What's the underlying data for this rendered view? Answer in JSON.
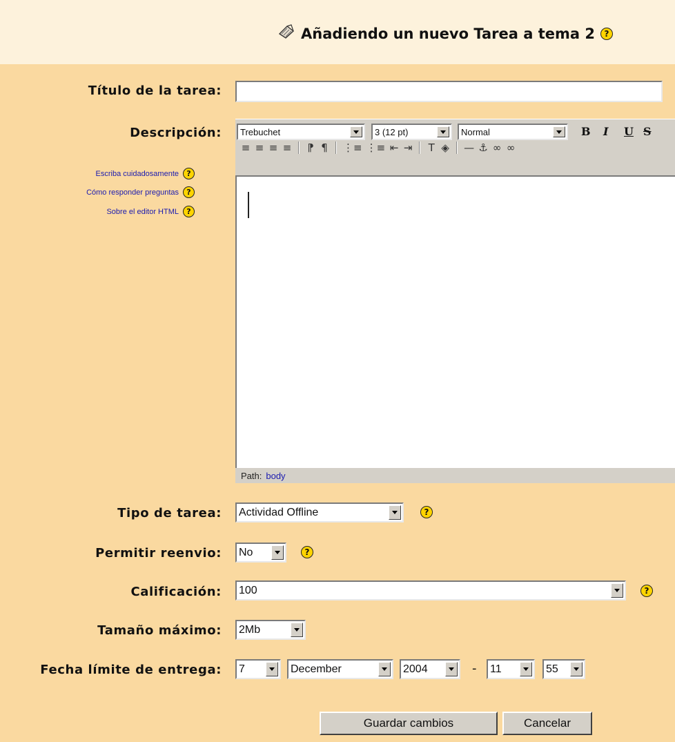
{
  "header": {
    "title": "Añadiendo un nuevo Tarea a tema 2",
    "help_glyph": "?",
    "icon": "assignment-icon"
  },
  "form": {
    "title_label": "Título de la tarea:",
    "title_value": "",
    "description_label": "Descripción:",
    "help_links": [
      "Escriba cuidadosamente",
      "Cómo responder preguntas",
      "Sobre el editor HTML"
    ],
    "editor": {
      "font": "Trebuchet",
      "size": "3 (12 pt)",
      "style": "Normal",
      "format_buttons": [
        "B",
        "I",
        "U",
        "S"
      ],
      "toolbar2": [
        "≡",
        "≡",
        "≡",
        "≡",
        "⁋",
        "¶",
        "⋮≡",
        "⋮≡",
        "⇤",
        "⇥",
        "T",
        "◈",
        "—",
        "⚓",
        "∞",
        "∞"
      ],
      "path_label": "Path:",
      "path_value": "body"
    },
    "task_type_label": "Tipo de tarea:",
    "task_type_value": "Actividad Offline",
    "resubmit_label": "Permitir reenvio:",
    "resubmit_value": "No",
    "grade_label": "Calificación:",
    "grade_value": "100",
    "max_size_label": "Tamaño máximo:",
    "max_size_value": "2Mb",
    "deadline_label": "Fecha límite de entrega:",
    "deadline": {
      "day": "7",
      "month": "December",
      "year": "2004",
      "separator": "-",
      "hour": "11",
      "minute": "55"
    }
  },
  "buttons": {
    "save": "Guardar cambios",
    "cancel": "Cancelar"
  },
  "colors": {
    "background": "#fad9a0",
    "header": "#fdf2dc",
    "help": "#ffd400",
    "link": "#1a1ab0"
  }
}
